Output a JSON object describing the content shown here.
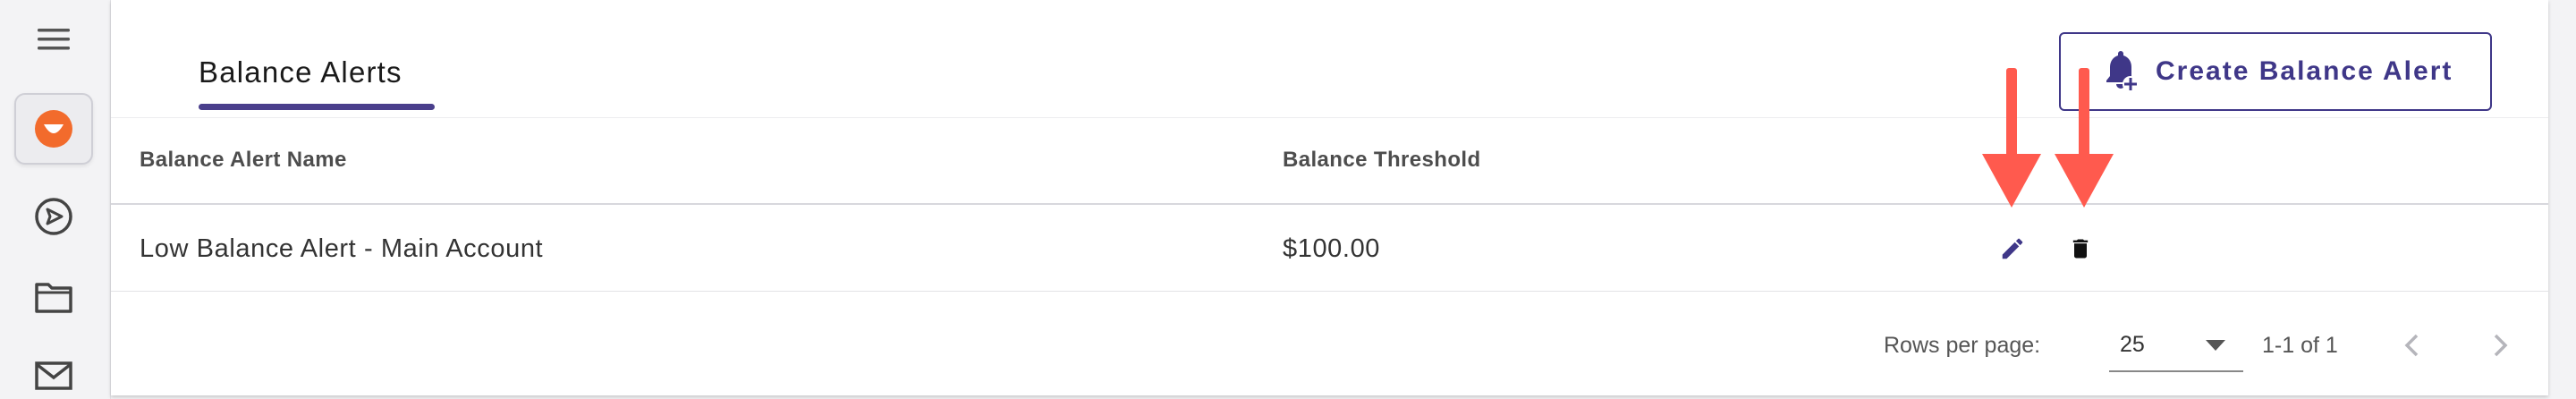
{
  "sidebar": {
    "items": [
      {
        "name": "menu",
        "icon": "menu-icon"
      },
      {
        "name": "brand",
        "icon": "brand-logo-icon",
        "active": true
      },
      {
        "name": "send",
        "icon": "send-icon"
      },
      {
        "name": "folder",
        "icon": "folder-icon"
      },
      {
        "name": "mail",
        "icon": "mail-icon"
      }
    ]
  },
  "header": {
    "tab_label": "Balance Alerts",
    "create_button_label": "Create Balance Alert"
  },
  "table": {
    "columns": [
      "Balance Alert Name",
      "Balance Threshold"
    ],
    "rows": [
      {
        "name": "Low Balance Alert - Main Account",
        "threshold": "$100.00"
      }
    ]
  },
  "pagination": {
    "rows_per_page_label": "Rows per page:",
    "rows_per_page_value": "25",
    "range_label": "1-1 of 1"
  },
  "colors": {
    "accent": "#4a3f8c",
    "brand_orange": "#f26b2c",
    "annotation_arrow": "#ff5a4e"
  }
}
